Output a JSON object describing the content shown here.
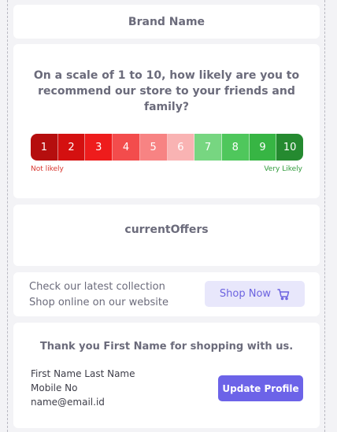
{
  "brand": {
    "name": "Brand Name"
  },
  "survey": {
    "question": "On a scale of 1 to 10, how likely are you to recommend our store to your friends and family?",
    "scale": [
      {
        "label": "1",
        "color": "#b50e0e"
      },
      {
        "label": "2",
        "color": "#d41010"
      },
      {
        "label": "3",
        "color": "#ee1c1c"
      },
      {
        "label": "4",
        "color": "#f34c4c"
      },
      {
        "label": "5",
        "color": "#f78383"
      },
      {
        "label": "6",
        "color": "#f9b3b3"
      },
      {
        "label": "7",
        "color": "#77d681"
      },
      {
        "label": "8",
        "color": "#4fc75c"
      },
      {
        "label": "9",
        "color": "#37b544"
      },
      {
        "label": "10",
        "color": "#258a30"
      }
    ],
    "low_label": "Not likely",
    "high_label": "Very Likely"
  },
  "offers": {
    "title": "currentOffers"
  },
  "promo": {
    "line1": "Check our latest collection",
    "line2": "Shop online on our website",
    "button_label": "Shop Now",
    "button_icon": "cart-icon"
  },
  "profile": {
    "thanks": "Thank you First Name for shopping with us.",
    "name": "First Name Last Name",
    "mobile": "Mobile No",
    "email": "name@email.id",
    "button_label": "Update Profile"
  }
}
